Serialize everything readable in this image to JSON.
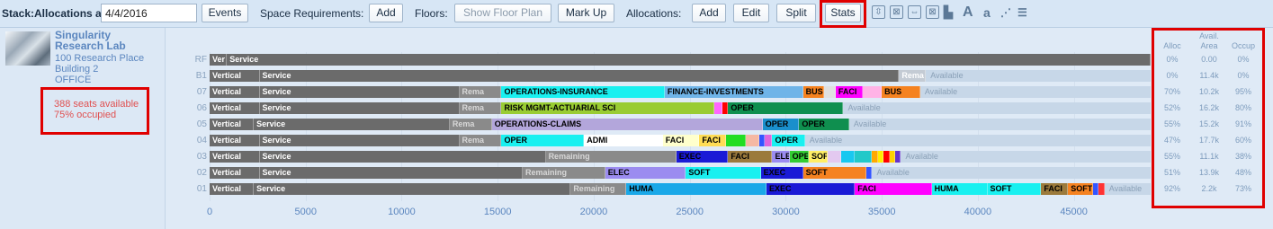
{
  "toolbar": {
    "stack_label": "Stack:Allocations as of:",
    "date_value": "4/4/2016",
    "events": "Events",
    "space_req_label": "Space Requirements:",
    "space_add": "Add",
    "floors_label": "Floors:",
    "show_floor_plan": "Show Floor Plan",
    "mark_up": "Mark Up",
    "allocations_label": "Allocations:",
    "alloc_add": "Add",
    "edit": "Edit",
    "split": "Split",
    "stats": "Stats",
    "icons": [
      "expand-icon",
      "collapse-icon",
      "fit-width-icon",
      "fit-both-icon",
      "legend-icon",
      "large-text-icon",
      "small-text-icon",
      "dotted-list-icon",
      "stack-layout-icon"
    ],
    "icon_glyphs": [
      "⇳",
      "⊠",
      "⇔",
      "⊠",
      "▙",
      "A",
      "a",
      "⋰",
      "☰"
    ]
  },
  "building": {
    "name": "Singularity Research Lab",
    "address": "100 Research Place",
    "building_no": "Building 2",
    "type": "OFFICE",
    "seats_available": "388 seats available",
    "occupied": "75% occupied"
  },
  "stats": {
    "headers": {
      "alloc": "Alloc",
      "avail_top": "Avail.",
      "avail_bottom": "Area",
      "occup": "Occup"
    },
    "rows": [
      {
        "alloc": "0%",
        "area": "0.00",
        "occup": "0%"
      },
      {
        "alloc": "0%",
        "area": "11.4k",
        "occup": "0%"
      },
      {
        "alloc": "70%",
        "area": "10.2k",
        "occup": "95%"
      },
      {
        "alloc": "52%",
        "area": "16.2k",
        "occup": "80%"
      },
      {
        "alloc": "55%",
        "area": "15.2k",
        "occup": "91%"
      },
      {
        "alloc": "47%",
        "area": "17.7k",
        "occup": "60%"
      },
      {
        "alloc": "55%",
        "area": "11.1k",
        "occup": "38%"
      },
      {
        "alloc": "51%",
        "area": "13.9k",
        "occup": "48%"
      },
      {
        "alloc": "92%",
        "area": "2.2k",
        "occup": "73%"
      }
    ]
  },
  "chart_data": {
    "type": "bar",
    "xlim": [
      0,
      49000
    ],
    "x_ticks": [
      0,
      5000,
      10000,
      15000,
      20000,
      25000,
      30000,
      35000,
      40000,
      45000
    ],
    "floors": [
      {
        "label": "RF",
        "total": 49000,
        "segments": [
          {
            "s": 0,
            "e": 900,
            "label": "Ver",
            "color": "#6b6b6b",
            "text": "#ffffff"
          },
          {
            "s": 900,
            "e": 49000,
            "label": "Service",
            "color": "#6b6b6b",
            "text": "#ffffff"
          }
        ]
      },
      {
        "label": "B1",
        "total": 49000,
        "avail_label": "Available",
        "segments": [
          {
            "s": 0,
            "e": 2600,
            "label": "Vertical",
            "color": "#6b6b6b",
            "text": "#ffffff"
          },
          {
            "s": 2600,
            "e": 35900,
            "label": "Service",
            "color": "#6b6b6b",
            "text": "#ffffff"
          },
          {
            "s": 35900,
            "e": 37300,
            "label": "Rema",
            "color": "#c4cbd4",
            "text": "#ffffff"
          }
        ]
      },
      {
        "label": "07",
        "total": 49000,
        "avail_label": "Available",
        "segments": [
          {
            "s": 0,
            "e": 2600,
            "label": "Vertical",
            "color": "#6b6b6b",
            "text": "#ffffff"
          },
          {
            "s": 2600,
            "e": 13000,
            "label": "Service",
            "color": "#6b6b6b",
            "text": "#ffffff"
          },
          {
            "s": 13000,
            "e": 15200,
            "label": "Rema",
            "color": "#8a8a8a",
            "text": "#d8d8d8"
          },
          {
            "s": 15200,
            "e": 23700,
            "label": "OPERATIONS-INSURANCE",
            "color": "#19f0f0",
            "text": "#000000"
          },
          {
            "s": 23700,
            "e": 30900,
            "label": "FINANCE-INVESTMENTS",
            "color": "#6fb4e8",
            "text": "#000000"
          },
          {
            "s": 30900,
            "e": 32000,
            "label": "BUS",
            "color": "#f58220",
            "text": "#000000"
          },
          {
            "s": 32000,
            "e": 32600,
            "label": "",
            "color": "#e0e0e0",
            "text": "#000000"
          },
          {
            "s": 32600,
            "e": 34000,
            "label": "FACI",
            "color": "#ff00ff",
            "text": "#000000"
          },
          {
            "s": 34000,
            "e": 35000,
            "label": "",
            "color": "#ffb3e6",
            "text": "#000000"
          },
          {
            "s": 35000,
            "e": 37000,
            "label": "BUS",
            "color": "#f58220",
            "text": "#000000"
          }
        ]
      },
      {
        "label": "06",
        "total": 49000,
        "avail_label": "Available",
        "segments": [
          {
            "s": 0,
            "e": 2600,
            "label": "Vertical",
            "color": "#6b6b6b",
            "text": "#ffffff"
          },
          {
            "s": 2600,
            "e": 13000,
            "label": "Service",
            "color": "#6b6b6b",
            "text": "#ffffff"
          },
          {
            "s": 13000,
            "e": 15200,
            "label": "Rema",
            "color": "#8a8a8a",
            "text": "#d8d8d8"
          },
          {
            "s": 15200,
            "e": 26300,
            "label": "RISK MGMT-ACTUARIAL SCI",
            "color": "#99cc33",
            "text": "#000000"
          },
          {
            "s": 26300,
            "e": 26700,
            "label": "",
            "color": "#ff66ff",
            "text": "#000000"
          },
          {
            "s": 26700,
            "e": 27000,
            "label": "",
            "color": "#ff0000",
            "text": "#000000"
          },
          {
            "s": 27000,
            "e": 33000,
            "label": "OPER",
            "color": "#0f8f4f",
            "text": "#000000"
          }
        ]
      },
      {
        "label": "05",
        "total": 49000,
        "avail_label": "Available",
        "segments": [
          {
            "s": 0,
            "e": 2300,
            "label": "Vertical",
            "color": "#6b6b6b",
            "text": "#ffffff"
          },
          {
            "s": 2300,
            "e": 12500,
            "label": "Service",
            "color": "#6b6b6b",
            "text": "#ffffff"
          },
          {
            "s": 12500,
            "e": 14700,
            "label": "Rema",
            "color": "#8a8a8a",
            "text": "#d8d8d8"
          },
          {
            "s": 14700,
            "e": 28800,
            "label": "OPERATIONS-CLAIMS",
            "color": "#b3a6db",
            "text": "#000000"
          },
          {
            "s": 28800,
            "e": 30700,
            "label": "OPER",
            "color": "#1a8fcc",
            "text": "#000000"
          },
          {
            "s": 30700,
            "e": 33300,
            "label": "OPER",
            "color": "#0f8f4f",
            "text": "#000000"
          }
        ]
      },
      {
        "label": "04",
        "total": 49000,
        "avail_label": "Available",
        "segments": [
          {
            "s": 0,
            "e": 2600,
            "label": "Vertical",
            "color": "#6b6b6b",
            "text": "#ffffff"
          },
          {
            "s": 2600,
            "e": 13000,
            "label": "Service",
            "color": "#6b6b6b",
            "text": "#ffffff"
          },
          {
            "s": 13000,
            "e": 15200,
            "label": "Rema",
            "color": "#8a8a8a",
            "text": "#d8d8d8"
          },
          {
            "s": 15200,
            "e": 19500,
            "label": "OPER",
            "color": "#19f0f0",
            "text": "#000000"
          },
          {
            "s": 19500,
            "e": 23600,
            "label": "ADMI",
            "color": "#ffffff",
            "text": "#000000"
          },
          {
            "s": 23600,
            "e": 25500,
            "label": "FACI",
            "color": "#ffffcc",
            "text": "#000000"
          },
          {
            "s": 25500,
            "e": 26900,
            "label": "FACI",
            "color": "#ffdd55",
            "text": "#000000"
          },
          {
            "s": 26900,
            "e": 27900,
            "label": "",
            "color": "#22dd22",
            "text": "#000000"
          },
          {
            "s": 27900,
            "e": 28600,
            "label": "",
            "color": "#f5b8a3",
            "text": "#000000"
          },
          {
            "s": 28600,
            "e": 28900,
            "label": "",
            "color": "#3355ff",
            "text": "#000000"
          },
          {
            "s": 28900,
            "e": 29300,
            "label": "",
            "color": "#dd66dd",
            "text": "#000000"
          },
          {
            "s": 29300,
            "e": 31000,
            "label": "OPER",
            "color": "#19f0f0",
            "text": "#000000"
          }
        ]
      },
      {
        "label": "03",
        "total": 49000,
        "avail_label": "Available",
        "segments": [
          {
            "s": 0,
            "e": 2600,
            "label": "Vertical",
            "color": "#6b6b6b",
            "text": "#ffffff"
          },
          {
            "s": 2600,
            "e": 17500,
            "label": "Service",
            "color": "#6b6b6b",
            "text": "#ffffff"
          },
          {
            "s": 17500,
            "e": 24300,
            "label": "Remaining",
            "color": "#8a8a8a",
            "text": "#d8d8d8"
          },
          {
            "s": 24300,
            "e": 27000,
            "label": "EXEC",
            "color": "#1a1ad6",
            "text": "#000000"
          },
          {
            "s": 27000,
            "e": 29300,
            "label": "FACI",
            "color": "#9b7a3c",
            "text": "#000000"
          },
          {
            "s": 29300,
            "e": 30200,
            "label": "ELEC",
            "color": "#9b8cf0",
            "text": "#000000"
          },
          {
            "s": 30200,
            "e": 31200,
            "label": "OPER",
            "color": "#33cc33",
            "text": "#000000"
          },
          {
            "s": 31200,
            "e": 32200,
            "label": "SOFT",
            "color": "#ffee66",
            "text": "#000000"
          },
          {
            "s": 32200,
            "e": 32900,
            "label": "",
            "color": "#e3c9f0",
            "text": "#000000"
          },
          {
            "s": 32900,
            "e": 33600,
            "label": "",
            "color": "#19c8f0",
            "text": "#000000"
          },
          {
            "s": 33600,
            "e": 34500,
            "label": "",
            "color": "#22c9c9",
            "text": "#000000"
          },
          {
            "s": 34500,
            "e": 34800,
            "label": "",
            "color": "#ffaa00",
            "text": "#000000"
          },
          {
            "s": 34800,
            "e": 35100,
            "label": "",
            "color": "#ffee00",
            "text": "#000000"
          },
          {
            "s": 35100,
            "e": 35400,
            "label": "",
            "color": "#ff0000",
            "text": "#000000"
          },
          {
            "s": 35400,
            "e": 35700,
            "label": "",
            "color": "#ffd000",
            "text": "#000000"
          },
          {
            "s": 35700,
            "e": 36000,
            "label": "",
            "color": "#6633cc",
            "text": "#000000"
          }
        ]
      },
      {
        "label": "02",
        "total": 49000,
        "avail_label": "Available",
        "segments": [
          {
            "s": 0,
            "e": 2600,
            "label": "Vertical",
            "color": "#6b6b6b",
            "text": "#ffffff"
          },
          {
            "s": 2600,
            "e": 16300,
            "label": "Service",
            "color": "#6b6b6b",
            "text": "#ffffff"
          },
          {
            "s": 16300,
            "e": 20600,
            "label": "Remaining",
            "color": "#8a8a8a",
            "text": "#d8d8d8"
          },
          {
            "s": 20600,
            "e": 24800,
            "label": "ELEC",
            "color": "#9b8cf0",
            "text": "#000000"
          },
          {
            "s": 24800,
            "e": 28700,
            "label": "SOFT",
            "color": "#19f0f0",
            "text": "#000000"
          },
          {
            "s": 28700,
            "e": 30900,
            "label": "EXEC",
            "color": "#1a1ad6",
            "text": "#000000"
          },
          {
            "s": 30900,
            "e": 34200,
            "label": "SOFT",
            "color": "#f58220",
            "text": "#000000"
          },
          {
            "s": 34200,
            "e": 34500,
            "label": "",
            "color": "#3355ff",
            "text": "#000000"
          }
        ]
      },
      {
        "label": "01",
        "total": 49000,
        "avail_label": "Available",
        "segments": [
          {
            "s": 0,
            "e": 2300,
            "label": "Vertical",
            "color": "#6b6b6b",
            "text": "#ffffff"
          },
          {
            "s": 2300,
            "e": 18800,
            "label": "Service",
            "color": "#6b6b6b",
            "text": "#ffffff"
          },
          {
            "s": 18800,
            "e": 21700,
            "label": "Remaining",
            "color": "#8a8a8a",
            "text": "#d8d8d8"
          },
          {
            "s": 21700,
            "e": 29000,
            "label": "HUMA",
            "color": "#1aa8e8",
            "text": "#000000"
          },
          {
            "s": 29000,
            "e": 33600,
            "label": "EXEC",
            "color": "#1a1ad6",
            "text": "#000000"
          },
          {
            "s": 33600,
            "e": 37600,
            "label": "FACI",
            "color": "#ff00ff",
            "text": "#000000"
          },
          {
            "s": 37600,
            "e": 40500,
            "label": "HUMA",
            "color": "#19f0f0",
            "text": "#000000"
          },
          {
            "s": 40500,
            "e": 43300,
            "label": "SOFT",
            "color": "#19f0f0",
            "text": "#000000"
          },
          {
            "s": 43300,
            "e": 44700,
            "label": "FACI",
            "color": "#9b7a3c",
            "text": "#000000"
          },
          {
            "s": 44700,
            "e": 46000,
            "label": "SOFT",
            "color": "#f58220",
            "text": "#000000"
          },
          {
            "s": 46000,
            "e": 46300,
            "label": "",
            "color": "#3355ff",
            "text": "#000000"
          },
          {
            "s": 46300,
            "e": 46600,
            "label": "",
            "color": "#ff3333",
            "text": "#000000"
          }
        ]
      }
    ]
  }
}
